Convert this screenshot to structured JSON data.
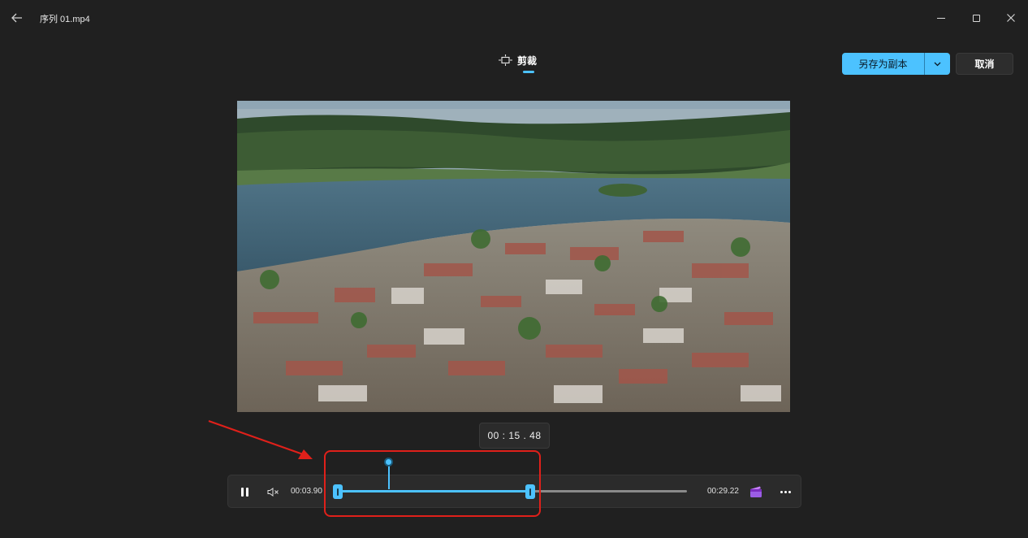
{
  "window": {
    "title": "序列 01.mp4",
    "icons": {
      "back": "back-arrow-icon",
      "minimize": "minimize-icon",
      "maximize": "maximize-icon",
      "close": "close-icon"
    }
  },
  "tab": {
    "label": "剪裁",
    "icon": "trim-icon",
    "active": true
  },
  "actions": {
    "save_copy_label": "另存为副本",
    "save_dropdown_icon": "chevron-down-icon",
    "cancel_label": "取消"
  },
  "player": {
    "tooltip_time": "00 : 15 . 48",
    "start_time": "00:03.90",
    "end_time": "00:29.22",
    "state": "playing",
    "icons": {
      "pause": "pause-icon",
      "mute": "mute-icon",
      "clip": "clapperboard-icon",
      "more": "more-icon"
    }
  },
  "colors": {
    "accent": "#4cc2ff",
    "background": "#202020",
    "panel": "#2b2b2b",
    "annotation": "#e0201a"
  }
}
